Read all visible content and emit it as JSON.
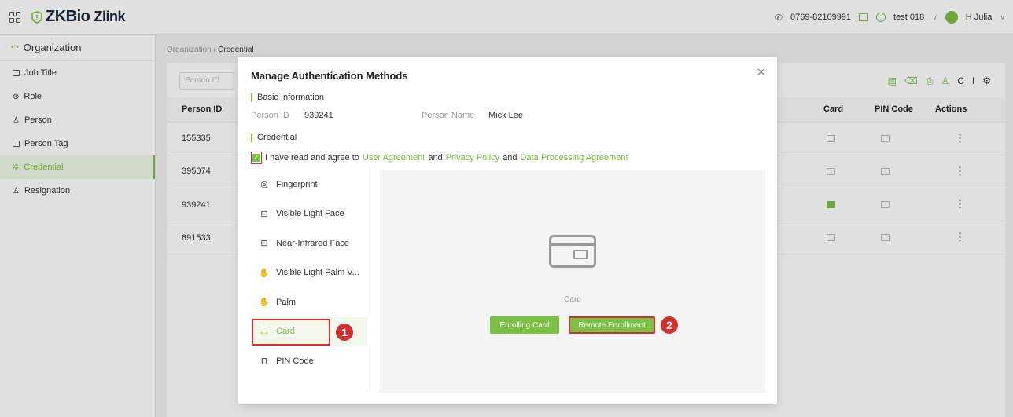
{
  "header": {
    "logo_text": "ZKBio",
    "logo_suffix": "Zlink",
    "phone": "0769-82109991",
    "company": "test 018",
    "user": "H Julia"
  },
  "sidebar": {
    "section": "Organization",
    "items": [
      {
        "label": "Job Title"
      },
      {
        "label": "Role"
      },
      {
        "label": "Person"
      },
      {
        "label": "Person Tag"
      },
      {
        "label": "Credential"
      },
      {
        "label": "Resignation"
      }
    ]
  },
  "breadcrumb": {
    "parent": "Organization",
    "sep": "/",
    "current": "Credential"
  },
  "background_table": {
    "search_placeholder": "Person ID",
    "columns": {
      "person_id": "Person ID",
      "card": "Card",
      "pin": "PIN Code",
      "actions": "Actions"
    },
    "rows": [
      {
        "id": "155335",
        "card_enrolled": false
      },
      {
        "id": "395074",
        "card_enrolled": false
      },
      {
        "id": "939241",
        "card_enrolled": true
      },
      {
        "id": "891533",
        "card_enrolled": false
      }
    ]
  },
  "modal": {
    "title": "Manage Authentication Methods",
    "basic_info_label": "Basic Information",
    "person_id_label": "Person ID",
    "person_id_value": "939241",
    "person_name_label": "Person Name",
    "person_name_value": "Mick Lee",
    "credential_label": "Credential",
    "agree_text": "I have read and agree to",
    "user_agreement": "User Agreement",
    "and1": "and",
    "privacy_policy": "Privacy Policy",
    "and2": "and",
    "data_agreement": "Data Processing Agreement",
    "methods": [
      {
        "label": "Fingerprint",
        "icon": "fingerprint-icon"
      },
      {
        "label": "Visible Light Face",
        "icon": "face-icon"
      },
      {
        "label": "Near-Infrared Face",
        "icon": "ir-face-icon"
      },
      {
        "label": "Visible Light Palm V...",
        "icon": "palm-vein-icon"
      },
      {
        "label": "Palm",
        "icon": "palm-icon"
      },
      {
        "label": "Card",
        "icon": "card-icon"
      },
      {
        "label": "PIN Code",
        "icon": "lock-icon"
      }
    ],
    "card_caption": "Card",
    "enroll_button": "Enrolling Card",
    "remote_button": "Remote Enrollment",
    "badge1": "1",
    "badge2": "2"
  },
  "colors": {
    "accent": "#7ac143",
    "highlight": "#d32f2f"
  }
}
